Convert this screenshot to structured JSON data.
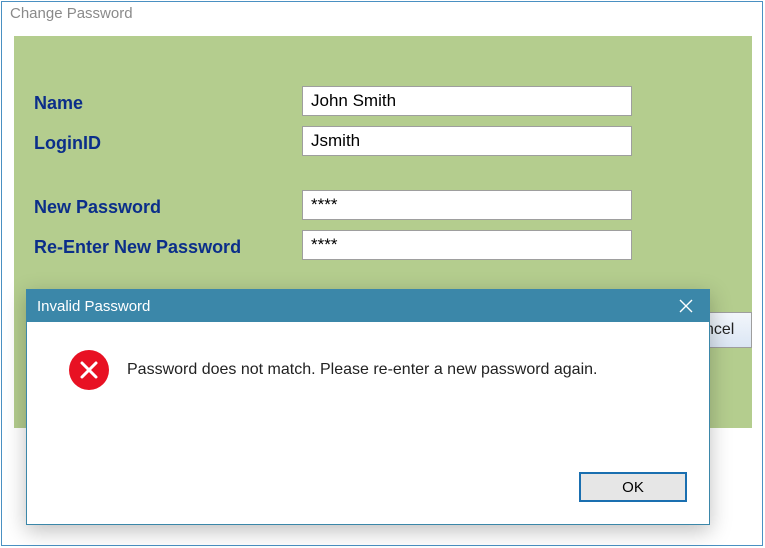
{
  "window": {
    "title": "Change Password"
  },
  "form": {
    "name_label": "Name",
    "name_value": "John Smith",
    "login_label": "LoginID",
    "login_value": "Jsmith",
    "newpw_label": "New Password",
    "newpw_value": "****",
    "repw_label": "Re-Enter New Password",
    "repw_value": "****",
    "cancel_label": "ncel"
  },
  "modal": {
    "title": "Invalid Password",
    "message": "Password does not match. Please re-enter a new password again.",
    "ok_label": "OK"
  }
}
